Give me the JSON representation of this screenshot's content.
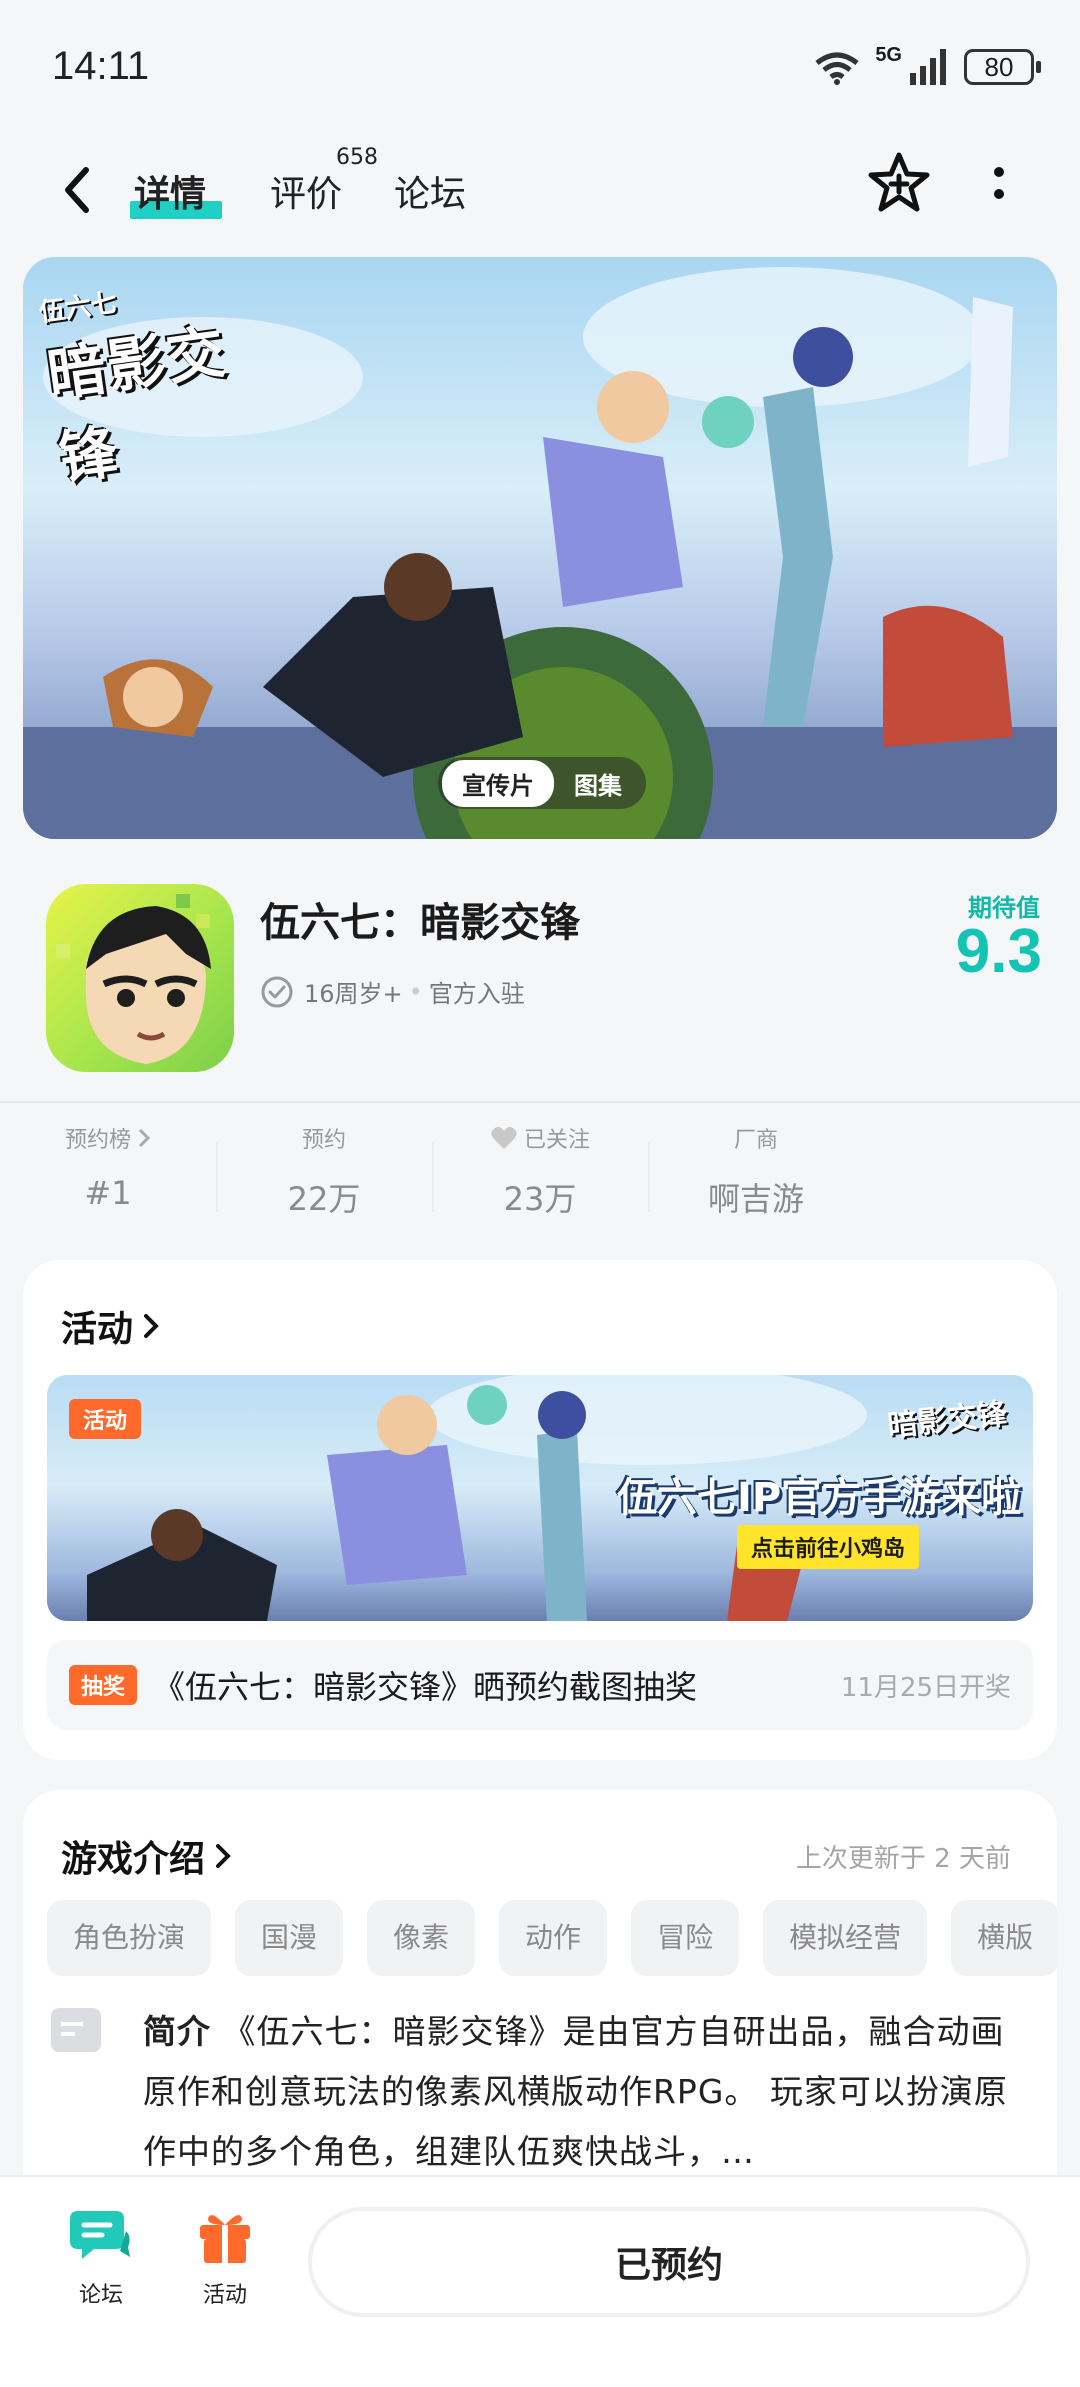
{
  "status_bar": {
    "time": "14:11",
    "network": "5G",
    "battery": "80"
  },
  "nav": {
    "tabs": [
      {
        "label": "详情"
      },
      {
        "label": "评价",
        "count": "658"
      },
      {
        "label": "论坛"
      }
    ]
  },
  "hero": {
    "logo_brand": "伍六七",
    "logo_title": "暗影交锋",
    "pills": [
      "宣传片",
      "图集"
    ]
  },
  "game": {
    "title": "伍六七：暗影交锋",
    "age": "16周岁+",
    "separator": "•",
    "official": "官方入驻",
    "score_label": "期待值",
    "score": "9.3"
  },
  "stats": [
    {
      "label": "预约榜",
      "value": "#1"
    },
    {
      "label": "预约",
      "value": "22万"
    },
    {
      "label": "已关注",
      "value": "23万"
    },
    {
      "label": "厂商",
      "value": "啊吉游"
    }
  ],
  "activity": {
    "title": "活动",
    "banner_tag": "活动",
    "banner_logo": "暗影交锋",
    "banner_headline": "伍六七IP官方手游来啦",
    "banner_cta": "点击前往小鸡岛",
    "lottery_tag": "抽奖",
    "lottery_text": "《伍六七：暗影交锋》晒预约截图抽奖",
    "lottery_date": "11月25日开奖"
  },
  "intro": {
    "title": "游戏介绍",
    "updated": "上次更新于 2 天前",
    "tags": [
      "角色扮演",
      "国漫",
      "像素",
      "动作",
      "冒险",
      "模拟经营",
      "横版"
    ],
    "label": "简介",
    "text": "《伍六七：暗影交锋》是由官方自研出品，融合动画原作和创意玩法的像素风横版动作RPG。 玩家可以扮演原作中的多个角色，组建队伍爽快战斗，…"
  },
  "bottom": {
    "forum_label": "论坛",
    "activity_label": "活动",
    "reserved_label": "已预约"
  },
  "colors": {
    "accent": "#20d0c4",
    "orange": "#ff6a2a",
    "score": "#13c4b4"
  }
}
